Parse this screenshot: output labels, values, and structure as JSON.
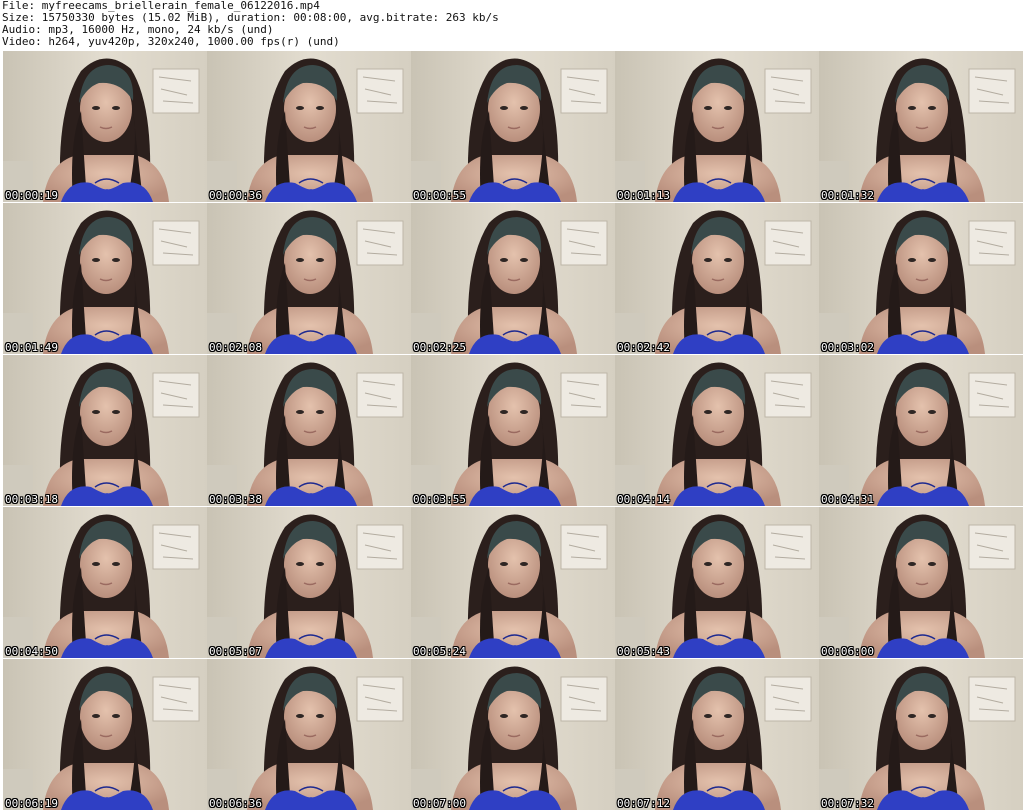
{
  "header": {
    "file_line": "File: myfreecams_briellerain_female_06122016.mp4",
    "size_line": "Size: 15750330 bytes (15.02 MiB), duration: 00:08:00, avg.bitrate: 263 kb/s",
    "audio_line": "Audio: mp3, 16000 Hz, mono, 24 kb/s (und)",
    "video_line": "Video: h264, yuv420p, 320x240, 1000.00 fps(r) (und)"
  },
  "thumbnails": [
    {
      "timestamp": "00:00:19"
    },
    {
      "timestamp": "00:00:36"
    },
    {
      "timestamp": "00:00:55"
    },
    {
      "timestamp": "00:01:13"
    },
    {
      "timestamp": "00:01:32"
    },
    {
      "timestamp": "00:01:49"
    },
    {
      "timestamp": "00:02:08"
    },
    {
      "timestamp": "00:02:25"
    },
    {
      "timestamp": "00:02:42"
    },
    {
      "timestamp": "00:03:02"
    },
    {
      "timestamp": "00:03:18"
    },
    {
      "timestamp": "00:03:38"
    },
    {
      "timestamp": "00:03:55"
    },
    {
      "timestamp": "00:04:14"
    },
    {
      "timestamp": "00:04:31"
    },
    {
      "timestamp": "00:04:50"
    },
    {
      "timestamp": "00:05:07"
    },
    {
      "timestamp": "00:05:24"
    },
    {
      "timestamp": "00:05:43"
    },
    {
      "timestamp": "00:06:00"
    },
    {
      "timestamp": "00:06:19"
    },
    {
      "timestamp": "00:06:36"
    },
    {
      "timestamp": "00:07:00"
    },
    {
      "timestamp": "00:07:12"
    },
    {
      "timestamp": "00:07:32"
    }
  ]
}
